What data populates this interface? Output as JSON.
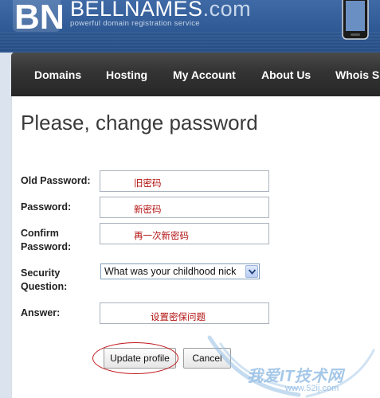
{
  "header": {
    "logo_mark": "BN",
    "logo_name": "BELLNAMES",
    "logo_tld": ".com",
    "tagline": "powerful domain registration service"
  },
  "nav": {
    "items": [
      {
        "label": "Domains"
      },
      {
        "label": "Hosting"
      },
      {
        "label": "My Account"
      },
      {
        "label": "About Us"
      },
      {
        "label": "Whois S"
      }
    ]
  },
  "page": {
    "title": "Please, change password"
  },
  "form": {
    "old_password": {
      "label": "Old Password:",
      "value": "旧密码"
    },
    "password": {
      "label": "Password:",
      "value": "新密码"
    },
    "confirm": {
      "label_line1": "Confirm",
      "label_line2": "Password:",
      "value": "再一次新密码"
    },
    "security_question": {
      "label_line1": "Security",
      "label_line2": "Question:",
      "selected": "What was your childhood nick"
    },
    "answer": {
      "label": "Answer:",
      "value": "设置密保问题"
    },
    "update_button": "Update profile",
    "cancel_button": "Cancel"
  },
  "watermark": {
    "text": "我爱IT技术网",
    "url": "www.52ij.com"
  },
  "colors": {
    "header_blue": "#2f5a95",
    "nav_dark": "#2b2b2b",
    "annotation_red": "#c0171b"
  }
}
